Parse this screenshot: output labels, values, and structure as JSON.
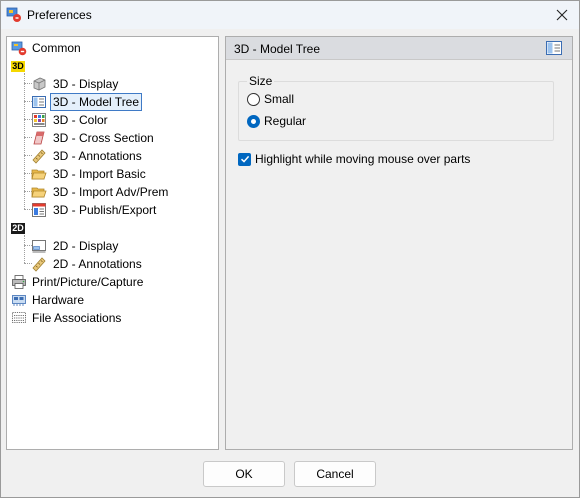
{
  "window": {
    "title": "Preferences",
    "icon": "preferences-app-icon",
    "close_icon": "close-icon"
  },
  "tree": {
    "items": [
      {
        "label": "Common",
        "icon": "common-settings-icon",
        "level": 0
      },
      {
        "label": "",
        "badge": "3D",
        "icon": "3d-group-icon",
        "level": 0
      },
      {
        "label": "3D - Display",
        "icon": "cube-display-icon",
        "level": 1
      },
      {
        "label": "3D - Model Tree",
        "icon": "model-tree-icon",
        "level": 1,
        "selected": true
      },
      {
        "label": "3D - Color",
        "icon": "color-palette-icon",
        "level": 1
      },
      {
        "label": "3D - Cross Section",
        "icon": "cross-section-icon",
        "level": 1
      },
      {
        "label": "3D - Annotations",
        "icon": "ruler-annotation-icon",
        "level": 1
      },
      {
        "label": "3D - Import Basic",
        "icon": "open-folder-icon",
        "level": 1
      },
      {
        "label": "3D - Import Adv/Prem",
        "icon": "open-folder-icon",
        "level": 1
      },
      {
        "label": "3D - Publish/Export",
        "icon": "publish-export-icon",
        "level": 1
      },
      {
        "label": "",
        "badge": "2D",
        "icon": "2d-group-icon",
        "level": 0
      },
      {
        "label": "2D - Display",
        "icon": "2d-display-icon",
        "level": 1
      },
      {
        "label": "2D - Annotations",
        "icon": "ruler-annotation-icon",
        "level": 1
      },
      {
        "label": "Print/Picture/Capture",
        "icon": "printer-icon",
        "level": 0
      },
      {
        "label": "Hardware",
        "icon": "hardware-chip-icon",
        "level": 0
      },
      {
        "label": "File Associations",
        "icon": "file-associations-icon",
        "level": 0
      }
    ]
  },
  "panel": {
    "title": "3D - Model Tree",
    "header_icon": "panel-layout-icon",
    "size_group": {
      "legend": "Size",
      "options": [
        {
          "label": "Small",
          "checked": false
        },
        {
          "label": "Regular",
          "checked": true
        }
      ]
    },
    "highlight_checkbox": {
      "label": "Highlight while moving mouse over parts",
      "checked": true
    }
  },
  "buttons": {
    "ok": "OK",
    "cancel": "Cancel"
  },
  "colors": {
    "accent": "#0067c0",
    "selection_border": "#3f7ac6",
    "badge_3d_bg": "#f5d800",
    "badge_2d_bg": "#1a1a1a"
  }
}
